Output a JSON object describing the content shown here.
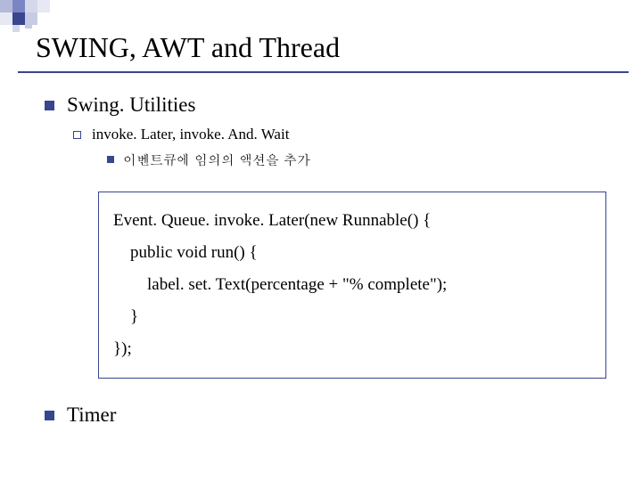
{
  "title": "SWING, AWT and Thread",
  "level1_a": "Swing. Utilities",
  "level2_a": "invoke. Later, invoke. And. Wait",
  "level3_a": "이벤트큐에 임의의 액션을 추가",
  "code": {
    "l1": "Event. Queue. invoke. Later(new Runnable() {",
    "l2": "    public void run() {",
    "l3": "        label. set. Text(percentage + \"% complete\");",
    "l4": "    }",
    "l5": "});"
  },
  "level1_b": "Timer"
}
